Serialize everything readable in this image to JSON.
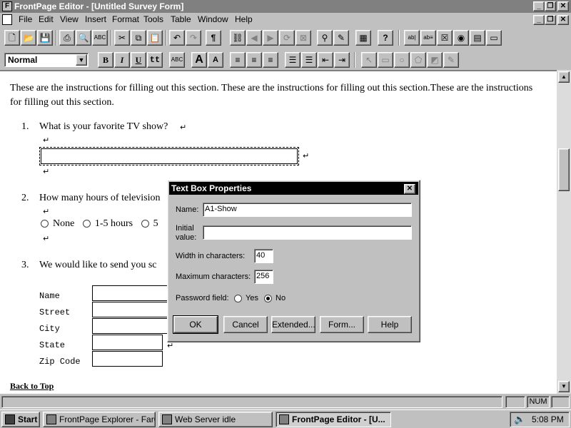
{
  "window": {
    "title": "FrontPage Editor - [Untitled Survey Form]",
    "minimize_glyph": "_",
    "restore_glyph": "❐",
    "close_glyph": "✕"
  },
  "menu": {
    "items": [
      "File",
      "Edit",
      "View",
      "Insert",
      "Format",
      "Tools",
      "Table",
      "Window",
      "Help"
    ]
  },
  "toolbar": {
    "icons": [
      "new-icon",
      "open-icon",
      "save-icon",
      "print-icon",
      "print-preview-icon",
      "spelling-icon",
      "cut-icon",
      "copy-icon",
      "paste-icon",
      "undo-icon",
      "redo-icon",
      "pilcrow-icon",
      "link-icon",
      "back-icon",
      "forward-icon",
      "refresh-icon",
      "stop-icon",
      "show-frontpage-explorer-icon",
      "show-to-do-list-icon",
      "insert-table-icon",
      "help-icon",
      "one-line-textbox-icon",
      "scrolling-textbox-icon",
      "checkbox-icon",
      "radio-button-icon",
      "dropdown-menu-icon",
      "push-button-icon"
    ],
    "pilcrow": "¶"
  },
  "format_toolbar": {
    "style_value": "Normal",
    "bold": "B",
    "italic": "I",
    "underline": "U",
    "fixed_width": "tt",
    "text_color": "ABC",
    "increase_size": "A",
    "decrease_size": "A"
  },
  "document": {
    "instructions": "These are the instructions for filling out this section. These are the instructions for filling out this section.These are the instructions for filling out this section.",
    "q1_number": "1.",
    "q1_text": "What is your favorite TV show?",
    "q2_number": "2.",
    "q2_text": "How many hours of television",
    "q2_options": [
      "None",
      "1-5 hours",
      "5"
    ],
    "q3_number": "3.",
    "q3_text": "We would like to send you sc",
    "address_labels": [
      "Name",
      "Street",
      "City",
      "State",
      "Zip Code"
    ],
    "back_link": "Back to Top",
    "return_glyph": "↵"
  },
  "status": {
    "num": "NUM"
  },
  "taskbar": {
    "start": "Start",
    "tasks": [
      "FrontPage Explorer - FarO...",
      "Web Server idle",
      "FrontPage Editor - [U..."
    ],
    "time": "5:08 PM"
  },
  "dialog": {
    "title": "Text Box Properties",
    "name_label": "Name:",
    "name_value": "A1-Show",
    "initial_label_1": "Initial",
    "initial_label_2": "value:",
    "initial_value": "",
    "width_label": "Width in characters:",
    "width_value": "40",
    "max_label": "Maximum characters:",
    "max_value": "256",
    "password_label": "Password field:",
    "password_yes": "Yes",
    "password_no": "No",
    "password_selected": "No",
    "buttons": [
      "OK",
      "Cancel",
      "Extended...",
      "Form...",
      "Help"
    ]
  }
}
